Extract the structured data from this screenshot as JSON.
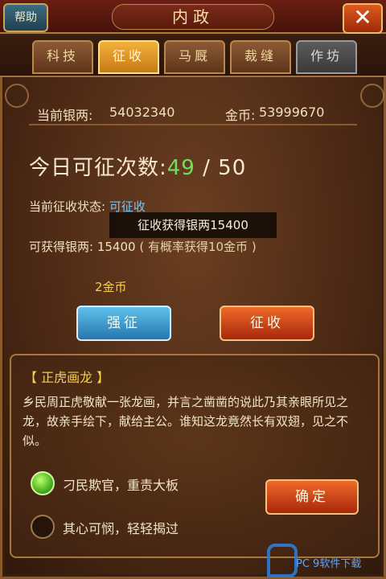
{
  "header": {
    "title": "内政",
    "help_label": "帮助",
    "close_icon": "close-icon"
  },
  "tabs": [
    {
      "label": "科技",
      "active": false
    },
    {
      "label": "征收",
      "active": true
    },
    {
      "label": "马厩",
      "active": false
    },
    {
      "label": "裁缝",
      "active": false
    },
    {
      "label": "作坊",
      "active": false
    }
  ],
  "currency": {
    "silver_label": "当前银两:",
    "silver_value": "54032340",
    "gold_label": "金币:",
    "gold_value": "53999670"
  },
  "collect_count": {
    "label": "今日可征次数:",
    "current": "49",
    "separator": " / ",
    "max": "50"
  },
  "status": {
    "label": "当前征收状态:",
    "value": "可征收"
  },
  "toast": "征收获得银两15400",
  "gain": {
    "label": "可获得银两:",
    "value": "15400",
    "note": "( 有概率获得10金币 )"
  },
  "force_cost": "2金币",
  "buttons": {
    "force": "强征",
    "collect": "征收",
    "confirm": "确定"
  },
  "event": {
    "title": "【 正虎画龙 】",
    "text": "乡民周正虎敬献一张龙画，并言之凿凿的说此乃其亲眼所见之龙，故亲手绘下，献给主公。谁知这龙竟然长有双翅，见之不似。",
    "options": [
      {
        "label": "刁民欺官，重责大板",
        "checked": true
      },
      {
        "label": "其心可悯，轻轻揭过",
        "checked": false
      }
    ]
  },
  "watermark": "PC 9软件下载",
  "colors": {
    "accent_gold": "#f7d046",
    "count_green": "#6fe05a",
    "force_blue": "#2675ad",
    "collect_red": "#a8270c"
  }
}
